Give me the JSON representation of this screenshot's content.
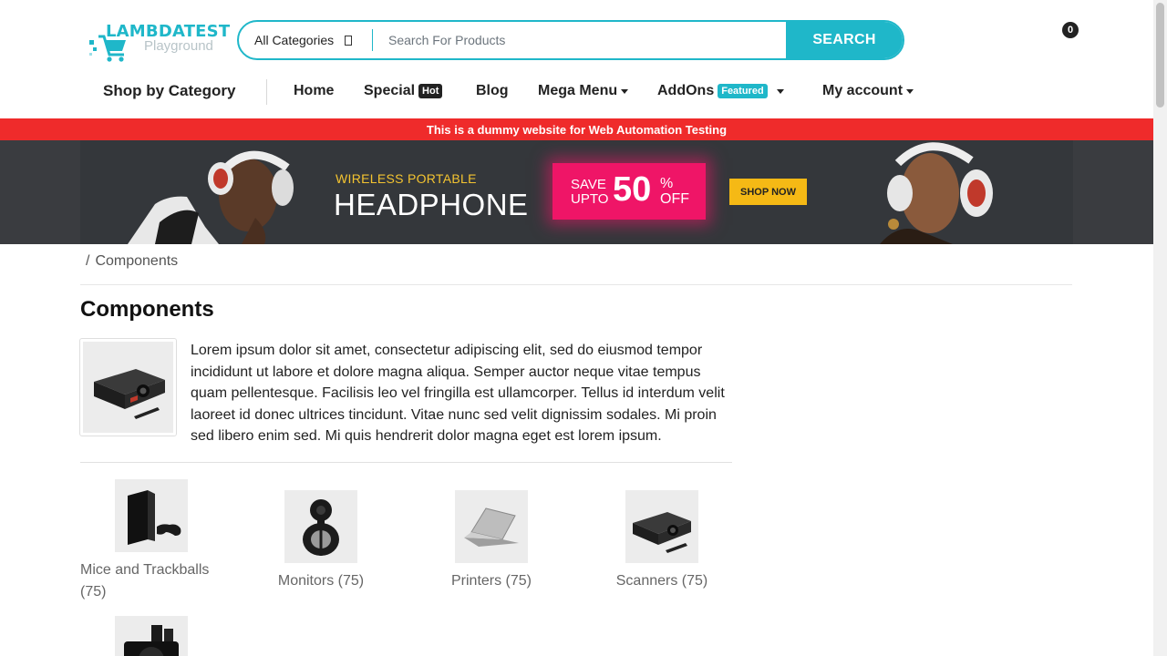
{
  "logo": {
    "main": "LAMBDATEST",
    "sub": "Playground"
  },
  "search": {
    "category": "All Categories",
    "placeholder": "Search For Products",
    "button": "SEARCH"
  },
  "cart": {
    "count": "0"
  },
  "nav": {
    "shop_by_category": "Shop by Category",
    "home": "Home",
    "special": "Special",
    "special_badge": "Hot",
    "blog": "Blog",
    "mega_menu": "Mega Menu",
    "addons": "AddOns",
    "addons_badge": "Featured",
    "my_account": "My account"
  },
  "notice": "This is a dummy website for Web Automation Testing",
  "banner": {
    "kicker": "WIRELESS PORTABLE",
    "title": "HEADPHONE",
    "save_line1": "SAVE",
    "save_line2": "UPTO",
    "save_number": "50",
    "save_pct": "%",
    "save_off": "OFF",
    "cta": "SHOP NOW"
  },
  "breadcrumb": {
    "separator": "/",
    "current": "Components"
  },
  "page": {
    "title": "Components",
    "description": "Lorem ipsum dolor sit amet, consectetur adipiscing elit, sed do eiusmod tempor incididunt ut labore et dolore magna aliqua. Semper auctor neque vitae tempus quam pellentesque. Facilisis leo vel fringilla est ullamcorper. Tellus id interdum velit laoreet id donec ultrices tincidunt. Vitae nunc sed velit dignissim sodales. Mi proin sed libero enim sed. Mi quis hendrerit dolor magna eget est lorem ipsum."
  },
  "subcategories": [
    {
      "label_line1": "Mice and Trackballs",
      "label_line2": "(75)",
      "icon": "game-console-icon"
    },
    {
      "label": "Monitors (75)",
      "icon": "webcam-icon"
    },
    {
      "label": "Printers (75)",
      "icon": "laptop-icon"
    },
    {
      "label": "Scanners (75)",
      "icon": "projector-icon"
    },
    {
      "icon": "camera-icon"
    }
  ],
  "colors": {
    "accent": "#1fb7c9",
    "notice_bg": "#ef2b2b",
    "banner_bg": "#34373b",
    "save_bg": "#ef1567",
    "cta_bg": "#f5b915"
  }
}
